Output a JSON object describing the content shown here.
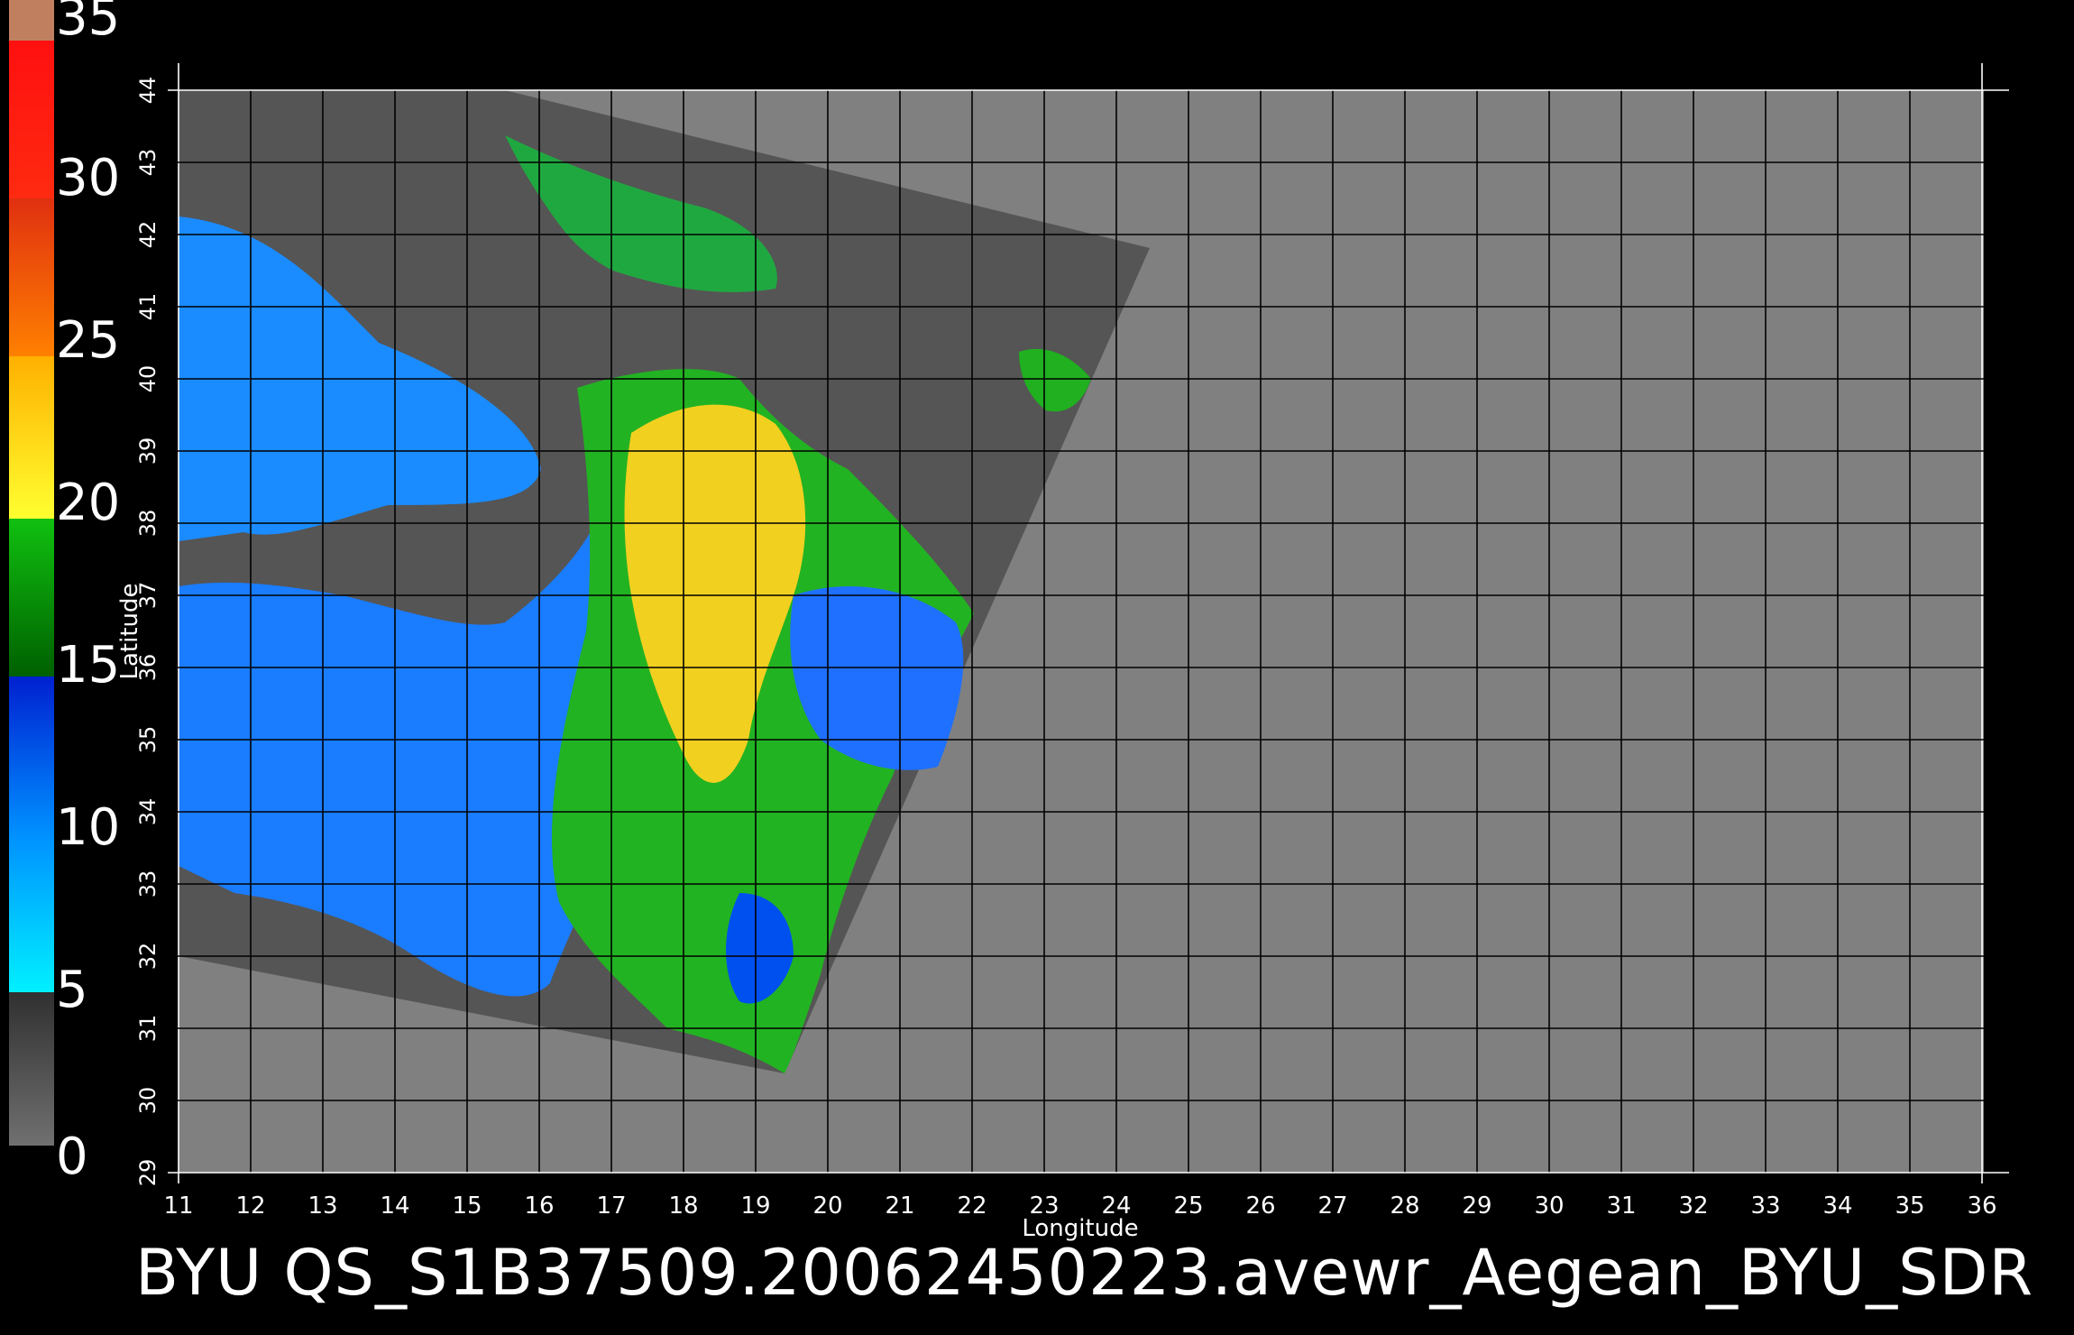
{
  "colorbar": {
    "labels": [
      "35",
      "30",
      "25",
      "20",
      "15",
      "10",
      "5",
      "0"
    ],
    "colors": {
      "brown": "#c08060",
      "red": "#ff1a1a",
      "orange": "#ff7a00",
      "yellow": "#ffe020",
      "green": "#00a000",
      "blue": "#0050ff",
      "cyan": "#00e8ff",
      "gray": "#606060"
    }
  },
  "map": {
    "xlabel": "Longitude",
    "ylabel": "Latitude",
    "lon_ticks": [
      "11",
      "12",
      "13",
      "14",
      "15",
      "16",
      "17",
      "18",
      "19",
      "20",
      "21",
      "22",
      "23",
      "24",
      "25",
      "26",
      "27",
      "28",
      "29",
      "30",
      "31",
      "32",
      "33",
      "34",
      "35",
      "36"
    ],
    "lat_ticks": [
      "29",
      "30",
      "31",
      "32",
      "33",
      "34",
      "35",
      "36",
      "37",
      "38",
      "39",
      "40",
      "41",
      "42",
      "43",
      "44"
    ],
    "lon_range": [
      11,
      36
    ],
    "lat_range": [
      29,
      44
    ],
    "background_color": "#808080",
    "swath_color": "#555555"
  },
  "caption": "BYU QS_S1B37509.20062450223.avewr_Aegean_BYU_SDR"
}
